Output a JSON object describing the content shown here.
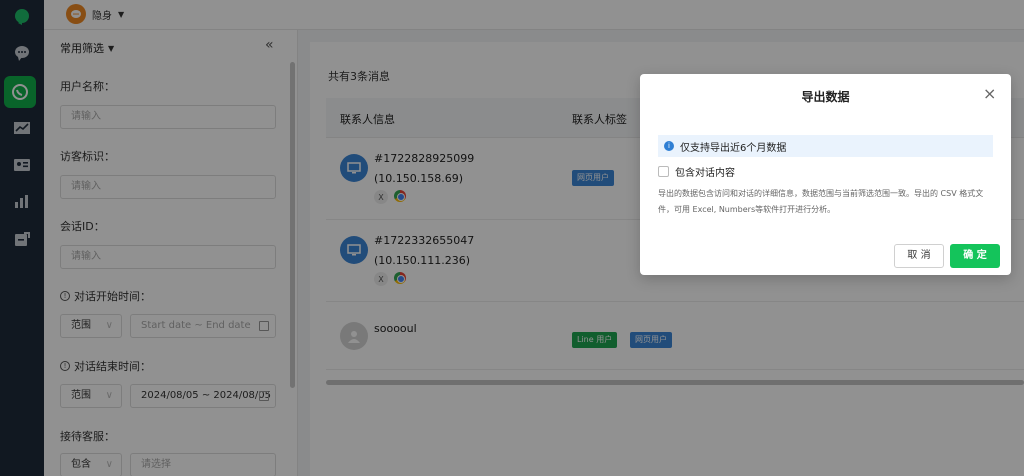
{
  "topbar": {
    "status_label": "隐身"
  },
  "rail": {
    "items": [
      {
        "icon": "logo-icon"
      },
      {
        "icon": "chat-bubble-icon"
      },
      {
        "icon": "whatsapp-icon",
        "active": true
      },
      {
        "icon": "trend-icon"
      },
      {
        "icon": "contact-card-icon"
      },
      {
        "icon": "bar-chart-icon"
      },
      {
        "icon": "export-icon"
      }
    ]
  },
  "filter": {
    "title": "常用筛选",
    "collapse_symbol": "«",
    "username_label": "用户名称：",
    "username_placeholder": "请输入",
    "visitor_label": "访客标识：",
    "visitor_placeholder": "请输入",
    "session_label": "会话ID：",
    "session_placeholder": "请输入",
    "start_label": "对话开始时间：",
    "start_mode": "范围",
    "start_range_placeholder": "Start date ~  End date",
    "end_label": "对话结束时间：",
    "end_mode": "范围",
    "end_range_value": "2024/08/05 ~ 2024/08/05",
    "agent_label": "接待客服：",
    "agent_mode": "包含",
    "agent_placeholder": "请选择"
  },
  "main": {
    "total_text": "共有3条消息",
    "columns": [
      "联系人信息",
      "联系人标签"
    ],
    "rows": [
      {
        "id": "#1722828925099",
        "ip": "(10.150.158.69)",
        "tags": [
          "网页用户"
        ]
      },
      {
        "id": "#1722332655047",
        "ip": "(10.150.111.236)",
        "tags": []
      },
      {
        "id": "sooooul",
        "ip": "",
        "tags": [
          "Line 用户",
          "网页用户"
        ]
      }
    ]
  },
  "modal": {
    "title": "导出数据",
    "close_symbol": "×",
    "note": "仅支持导出近6个月数据",
    "checkbox_label": "包含对话内容",
    "description": "导出的数据包含访问和对话的详细信息，数据范围与当前筛选范围一致。导出的 CSV 格式文件，可用 Excel, Numbers等软件打开进行分析。",
    "cancel_label": "取 消",
    "confirm_label": "确 定"
  },
  "colors": {
    "brand_green": "#14c45b",
    "rail_bg": "#1e2b3a",
    "tag_blue": "#3a86d6",
    "tag_green": "#1ea552"
  }
}
